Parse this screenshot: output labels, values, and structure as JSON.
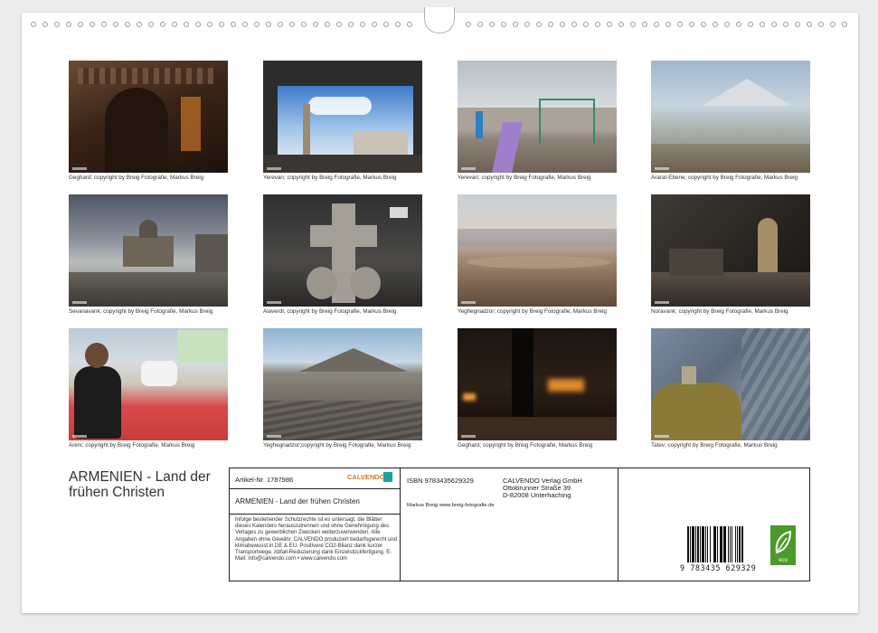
{
  "photos": [
    {
      "caption": "Geghard; copyright by Breig Fotografie, Markus Breig",
      "scene": "carved-stone-portal"
    },
    {
      "caption": "Yerevan; copyright by Breig Fotografie, Markus Breig",
      "scene": "monument-through-arch"
    },
    {
      "caption": "Yerevan; copyright by Breig Fotografie, Markus Breig",
      "scene": "playground-slide"
    },
    {
      "caption": "Ararat-Ebene; copyright by Breig Fotografie, Markus Breig",
      "scene": "ararat-plain"
    },
    {
      "caption": "Sevanavank; copyright by Breig Fotografie, Markus Breig",
      "scene": "church-storm-sky"
    },
    {
      "caption": "Alaverdi; copyright by Breig Fotografie, Markus Breig",
      "scene": "khachkar-cross"
    },
    {
      "caption": "Yeghegnadzor; copyright by Breig Fotografie, Markus Breig",
      "scene": "mountain-valley"
    },
    {
      "caption": "Noravank; copyright by Breig Fotografie, Markus Breig",
      "scene": "dark-church-interior"
    },
    {
      "caption": "Areni; copyright by Breig Fotografie, Markus Breig",
      "scene": "wrestling-festival"
    },
    {
      "caption": "Yeghegnadzor;copyright by Breig Fotografie, Markus Breig",
      "scene": "bare-hills"
    },
    {
      "caption": "Geghard; copyright by Breig Fotografie, Markus Breig",
      "scene": "candlelit-cave"
    },
    {
      "caption": "Tatev; copyright by Breig Fotografie, Markus Breig",
      "scene": "monastery-gorge"
    }
  ],
  "title": "ARMENIEN - Land der frühen Christen",
  "info": {
    "article": "Artikel-Nr. 1787986",
    "publisher_logo": "CALVENDO",
    "subtitle": "ARMENIEN - Land der frühen Christen",
    "isbn": "ISBN 9783435629329",
    "publisher_name": "CALVENDO Verlag GmbH",
    "publisher_street": "Ottobrunner Straße 39",
    "publisher_city": "D-82008 Unterhaching",
    "author": "Markus Breig www.breig-fotografie.de",
    "legal": "Infolge bestehender Schutzrechte ist es untersagt, die Blätter dieses Kalenders herauszutrennen und ohne Genehmigung des Verlages zu gewerblichen Zwecken weiterzuverwenden. Alle Angaben ohne Gewähr. CALVENDO produziert bedarfsgerecht und klimabewusst in DE & EU. Positivere CO2-Bilanz dank kurzer Transportwege. Abfall-Reduzierung dank Einzelstückfertigung. E-Mail: info@calvendo.com • www.calvendo.com",
    "barcode_number": "9 783435 629329",
    "eco_label": "eco"
  },
  "colors": {
    "accent_teal": "#1aa39a",
    "eco_green": "#4c9a2a"
  }
}
